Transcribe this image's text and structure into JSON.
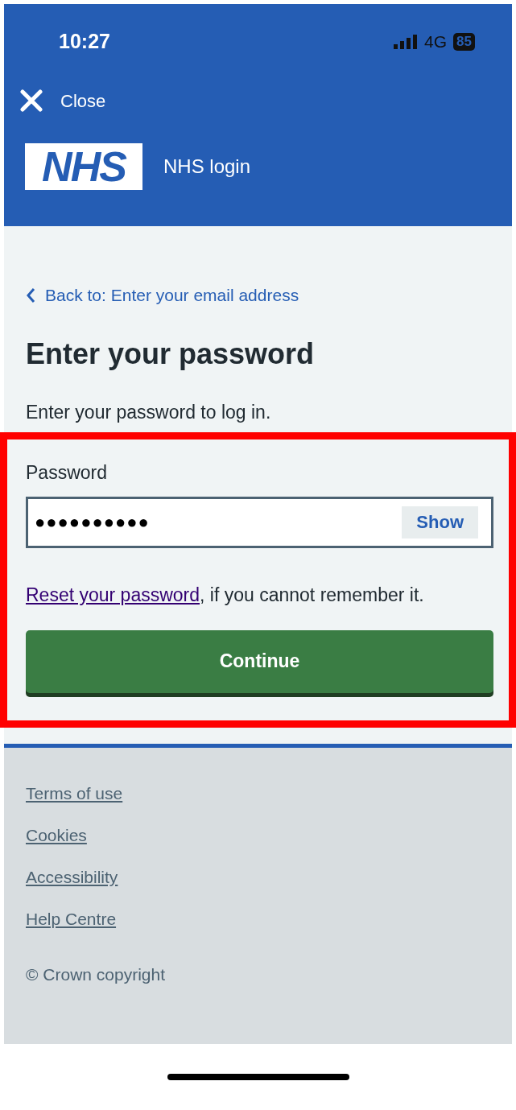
{
  "status_bar": {
    "time": "10:27",
    "network": "4G",
    "battery": "85"
  },
  "header": {
    "close": "Close",
    "logo": "NHS",
    "service": "NHS login"
  },
  "back_link": "Back to: Enter your email address",
  "heading": "Enter your password",
  "intro": "Enter your password to log in.",
  "password": {
    "label": "Password",
    "value": "●●●●●●●●●●",
    "show_button": "Show"
  },
  "reset": {
    "link": "Reset your password",
    "rest": ", if you cannot remember it."
  },
  "continue_button": "Continue",
  "footer": {
    "links": [
      "Terms of use",
      "Cookies",
      "Accessibility",
      "Help Centre"
    ],
    "copyright": "© Crown copyright"
  }
}
